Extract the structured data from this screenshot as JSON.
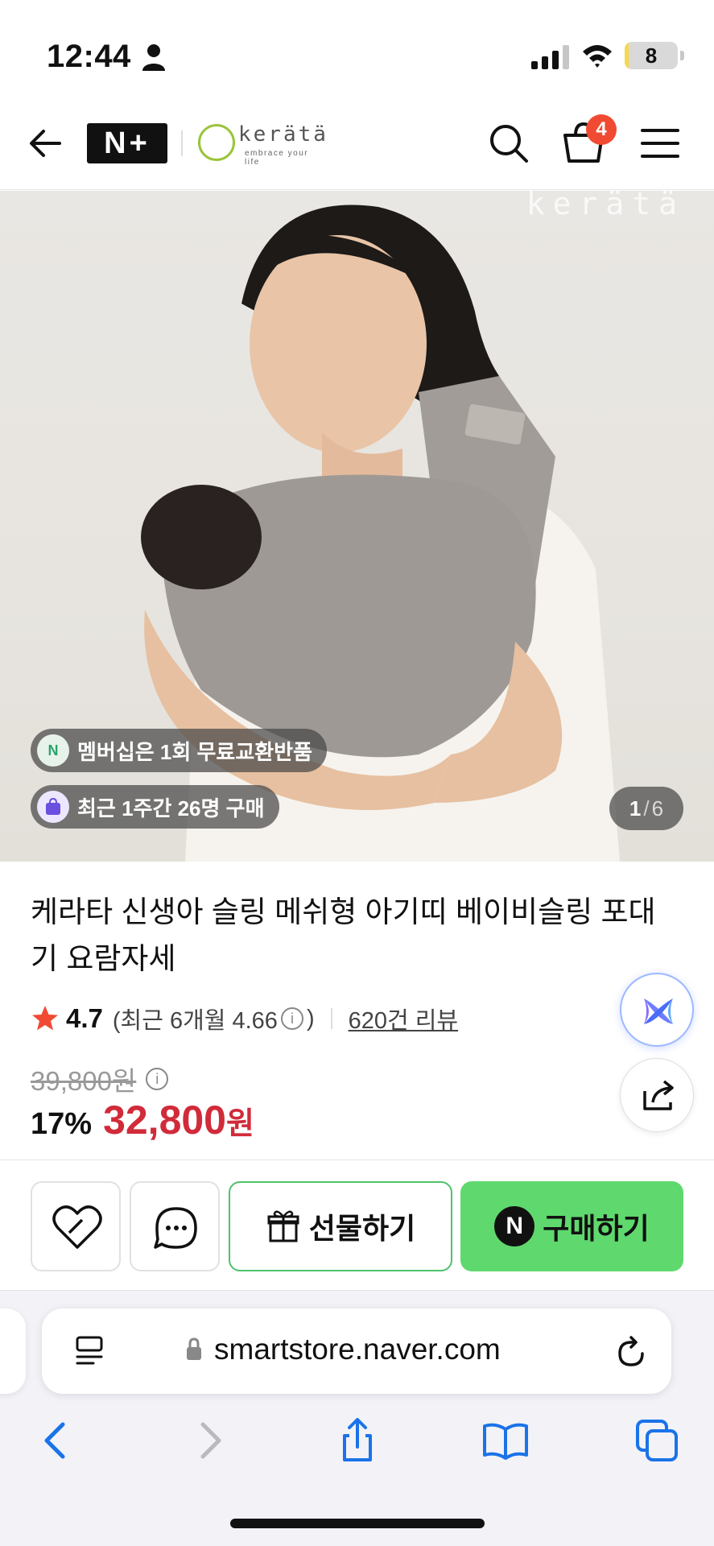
{
  "status_bar": {
    "time": "12:44",
    "battery": "8",
    "battery_fraction": 0.08
  },
  "header": {
    "nplus_logo": "N+",
    "brand_logo": "kerätä",
    "brand_tagline": "embrace your life",
    "cart_count": "4"
  },
  "hero": {
    "watermark": "kerätä",
    "promo_membership": "멤버십은 1회 무료교환반품",
    "promo_membership_icon_text": "N",
    "promo_recent": "최근 1주간 26명 구매",
    "page_current": "1",
    "page_separator": "/",
    "page_total": "6"
  },
  "product": {
    "title": "케라타 신생아 슬링 메쉬형 아기띠 베이비슬링 포대기 요람자세",
    "rating": "4.7",
    "recent_rating_prefix": "(최근 6개월 4.66",
    "recent_rating_suffix": ")",
    "review_link": "620건 리뷰",
    "original_price": "39,800원",
    "discount": "17%",
    "price": "32,800",
    "currency": "원"
  },
  "actions": {
    "gift_label": "선물하기",
    "buy_label": "구매하기",
    "buy_icon_text": "N"
  },
  "browser": {
    "url": "smartstore.naver.com"
  },
  "colors": {
    "price_red": "#d12b3a",
    "naver_green": "#5fd96e",
    "gift_border": "#4fc26a",
    "badge_red": "#f04b32"
  }
}
